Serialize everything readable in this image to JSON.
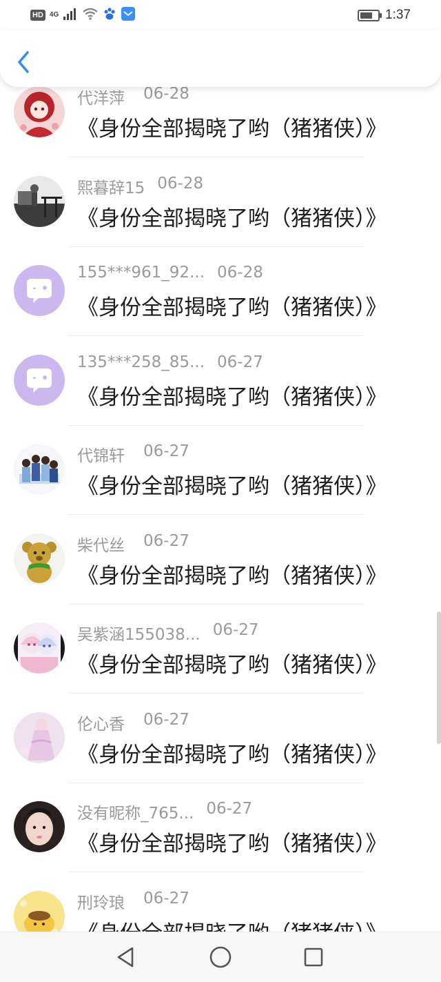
{
  "status_bar": {
    "network_hd": "HD",
    "network_type": "4G",
    "time": "1:37",
    "battery_level": 0.75,
    "icons": [
      "hd-icon",
      "signal-icon",
      "wifi-icon",
      "baidu-paw-icon",
      "mail-icon",
      "battery-icon"
    ]
  },
  "header": {
    "back_icon": "chevron-left-icon",
    "accent_color": "#2e8ff0"
  },
  "list": {
    "items": [
      {
        "name": "代洋萍",
        "date": "06-28",
        "message": "《身份全部揭晓了哟（猪猪侠）》",
        "avatar": "anime-girl-red"
      },
      {
        "name": "熙暮辞15",
        "date": "06-28",
        "message": "《身份全部揭晓了哟（猪猪侠）》",
        "avatar": "photo-bridge"
      },
      {
        "name": "155***961_92...",
        "date": "06-28",
        "message": "《身份全部揭晓了哟（猪猪侠）》",
        "avatar": "default-chat-purple"
      },
      {
        "name": "135***258_85...",
        "date": "06-27",
        "message": "《身份全部揭晓了哟（猪猪侠）》",
        "avatar": "default-chat-purple"
      },
      {
        "name": "代锦轩",
        "date": "06-27",
        "message": "《身份全部揭晓了哟（猪猪侠）》",
        "avatar": "group-photo"
      },
      {
        "name": "柴代丝",
        "date": "06-27",
        "message": "《身份全部揭晓了哟（猪猪侠）》",
        "avatar": "teddy-bear"
      },
      {
        "name": "吴紫涵155038...",
        "date": "06-27",
        "message": "《身份全部揭晓了哟（猪猪侠）》",
        "avatar": "anime-girls-pink"
      },
      {
        "name": "伦心香",
        "date": "06-27",
        "message": "《身份全部揭晓了哟（猪猪侠）》",
        "avatar": "pink-dress"
      },
      {
        "name": "没有昵称_765...",
        "date": "06-27",
        "message": "《身份全部揭晓了哟（猪猪侠）》",
        "avatar": "selfie-girl"
      },
      {
        "name": "刑玲琅",
        "date": "06-27",
        "message": "《身份全部揭晓了哟（猪猪侠）》",
        "avatar": "yellow-pudding"
      }
    ]
  },
  "navbar": {
    "icons": [
      "back-triangle-icon",
      "home-circle-icon",
      "recents-square-icon"
    ]
  }
}
